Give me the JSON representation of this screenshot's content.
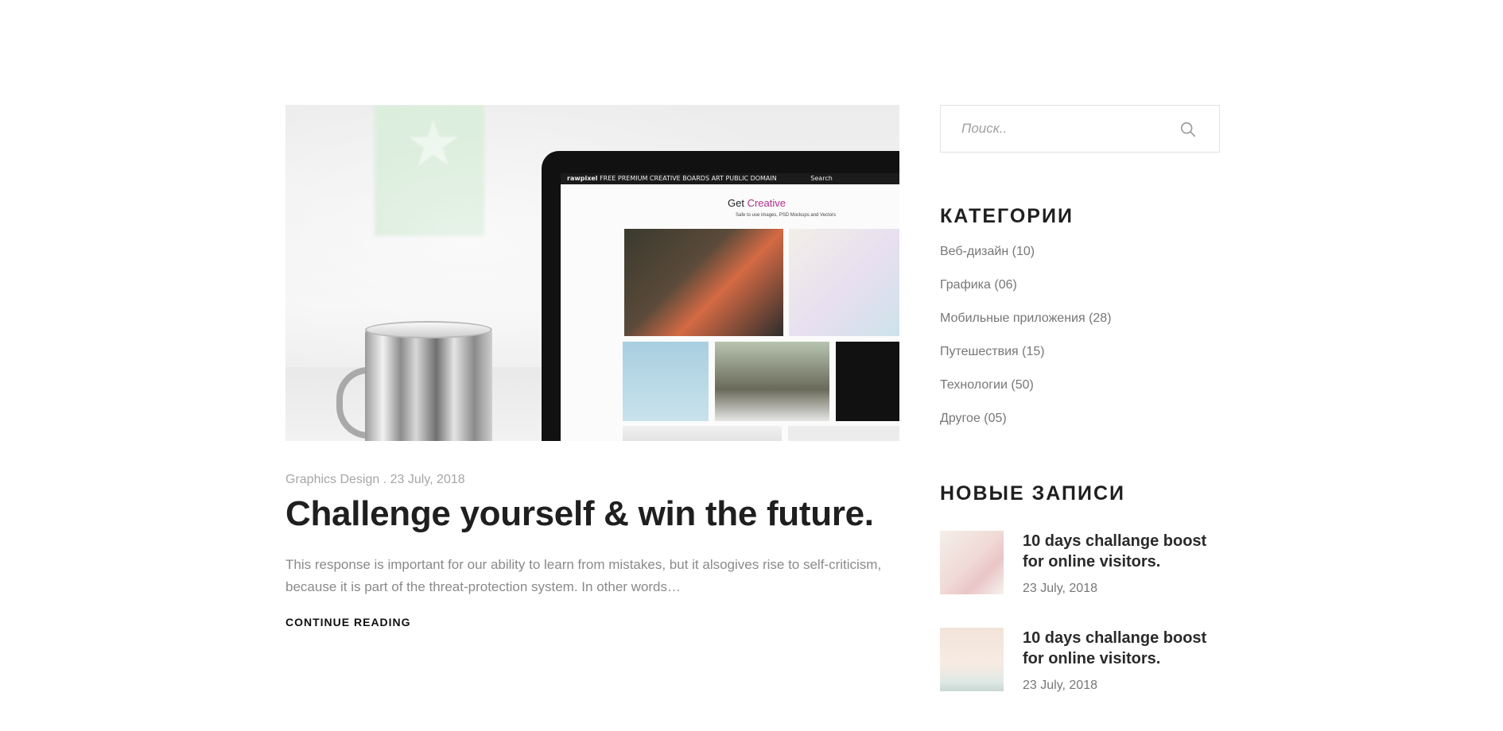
{
  "search": {
    "placeholder": "Поиск..",
    "icon": "search-icon"
  },
  "article": {
    "category": "Graphics Design",
    "separator": ".",
    "date": "23 July, 2018",
    "title": "Challenge yourself & win the future.",
    "excerpt": "This response is important for our ability to learn from mistakes, but it alsogives rise to self-criticism, because it is part of the threat-protection system. In other words…",
    "continue_label": "CONTINUE READING",
    "image": {
      "site_name": "rawpixel",
      "nav": "FREE  PREMIUM  CREATIVE BOARDS  ART  PUBLIC DOMAIN",
      "search_placeholder": "Search",
      "headline_prefix": "Get",
      "headline_accent": "Creative",
      "tagline": "Safe to use images, PSD Mockups and Vectors"
    }
  },
  "categories": {
    "title": "КАТЕГОРИИ",
    "items": [
      {
        "label": "Веб-дизайн (10)"
      },
      {
        "label": "Графика (06)"
      },
      {
        "label": "Мобильные приложения (28)"
      },
      {
        "label": "Путешествия (15)"
      },
      {
        "label": "Технологии (50)"
      },
      {
        "label": "Другое (05)"
      }
    ]
  },
  "recent_posts": {
    "title": "НОВЫЕ ЗАПИСИ",
    "items": [
      {
        "title": "10 days challange boost for online visitors.",
        "date": "23 July, 2018"
      },
      {
        "title": "10 days challange boost for online visitors.",
        "date": "23 July, 2018"
      }
    ]
  },
  "colors": {
    "text": "#1f1f1f",
    "muted": "#8a8a8a",
    "meta": "#a6a6a6",
    "accent": "#b42d8c",
    "border": "#e2e2e2"
  }
}
